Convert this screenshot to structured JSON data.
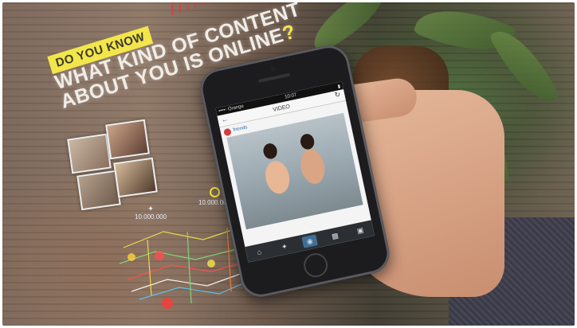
{
  "overlay": {
    "badge": "DO YOU KNOW",
    "headline_line1": "WHAT KIND OF CONTENT",
    "headline_line2": "ABOUT YOU IS ONLINE",
    "headline_mark": "?",
    "tweet_count_1": "10.000.000",
    "tweet_count_2": "10.000.000"
  },
  "phone": {
    "carrier": "••••◦ Orange",
    "time": "10:07",
    "nav_title": "VIDEO",
    "username": "friends"
  },
  "colors": {
    "accent_yellow": "#f2e64a",
    "accent_red": "#e23a3a",
    "tab_active": "#3f6e98"
  },
  "icons": [
    "back-arrow-icon",
    "refresh-icon",
    "home-icon",
    "star-icon",
    "camera-icon",
    "photo-icon",
    "message-icon",
    "twitter-bird-icon",
    "target-icon"
  ]
}
